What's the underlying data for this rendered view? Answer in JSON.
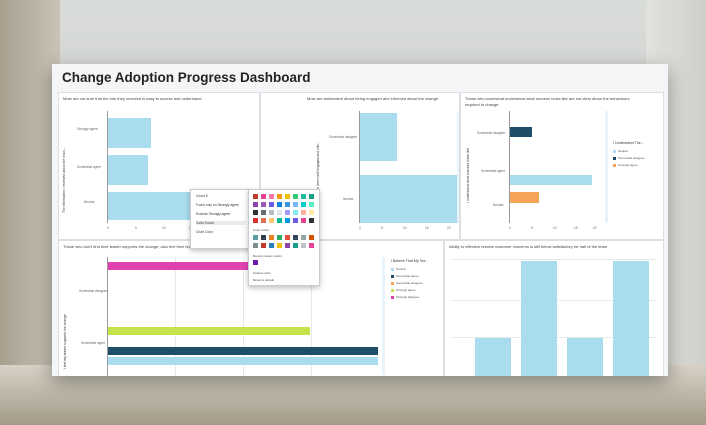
{
  "dashboard": {
    "title": "Change Adoption Progress Dashboard"
  },
  "colors": {
    "light_blue": "#a8dcee",
    "dark_blue": "#1f4e6b",
    "orange": "#f5a55a",
    "lime": "#c5e34a",
    "magenta": "#e040b0"
  },
  "panel1": {
    "title": "Most are not sure that the info they received is easy to access and understand",
    "y_axis": "The information I received about the chan...",
    "categories": [
      "Strongly agree",
      "Somewhat agree",
      "Neutral"
    ],
    "x_ticks": [
      "0",
      "5",
      "10",
      "15",
      "20",
      "25",
      "30"
    ]
  },
  "panel2": {
    "title": "Most are ambivalent about being engaged and informed about the change",
    "y_axis": "I feel that I have been well engaged and info...",
    "categories": [
      "Somewhat disagree",
      "Neutral"
    ],
    "x_ticks": [
      "0",
      "5",
      "10",
      "15",
      "20",
      "25",
      "30"
    ]
  },
  "panel3": {
    "title_line1": "Those who somewhat understand what success looks like are not clear about the behaviours",
    "title_line2": "required to change.",
    "y_axis": "I understand what success looks like",
    "categories": [
      "Somewhat disagree",
      "Somewhat agree",
      "Neutral"
    ],
    "x_ticks": [
      "0",
      "5",
      "10",
      "15",
      "20"
    ],
    "legend_title": "I Understand The...",
    "legend": [
      "Neutral",
      "Somewhat disagree",
      "Strongly agree"
    ]
  },
  "panel4": {
    "title": "Those who don't find their leader supports the change, also feel their team do not support the change.",
    "y_axis": "I feel my leader supports the change",
    "categories": [
      "Somewhat disagree",
      "Somewhat agree"
    ],
    "legend_title": "I Believe That My Tea...",
    "legend": [
      "Neutral",
      "Somewhat agree",
      "Somewhat disagree",
      "Strongly agree",
      "Strongly disagree"
    ]
  },
  "panel5": {
    "title": "Ability to effective resolve customer concerns is still below satisfactory for half of the team"
  },
  "context_menu": {
    "items": [
      "Count 8",
      "Focus only on Strongly agree",
      "Exclude Strongly agree",
      "Color Count",
      "Chart Color"
    ]
  },
  "color_picker": {
    "label_colors": "Color colors",
    "label_recent": "Recent custom colors",
    "label_custom": "Custom color",
    "label_reset": "Reset to default"
  },
  "visual_controls": {
    "label": "↗ ⋯"
  },
  "chart_data": [
    {
      "type": "bar",
      "title": "Most are not sure that the info they received is easy to access and understand",
      "categories": [
        "Strongly agree",
        "Somewhat agree",
        "Neutral"
      ],
      "values": [
        9,
        13,
        25
      ],
      "xlim": [
        0,
        30
      ]
    },
    {
      "type": "bar",
      "title": "Most are ambivalent about being engaged and informed about the change",
      "categories": [
        "Somewhat disagree",
        "Neutral"
      ],
      "values": [
        7,
        28
      ],
      "xlim": [
        0,
        30
      ]
    },
    {
      "type": "bar",
      "title": "Those who somewhat understand what success looks like are not clear about the behaviours required to change.",
      "categories": [
        "Somewhat disagree",
        "Somewhat agree",
        "Neutral"
      ],
      "series": [
        {
          "name": "Neutral",
          "values": [
            0,
            16,
            0
          ]
        },
        {
          "name": "Somewhat disagree",
          "values": [
            3,
            0,
            0
          ]
        },
        {
          "name": "Strongly agree",
          "values": [
            0,
            0,
            4
          ]
        }
      ],
      "xlim": [
        0,
        22
      ]
    },
    {
      "type": "bar",
      "title": "Those who don't find their leader supports the change, also feel their team do not support the change.",
      "categories": [
        "Somewhat disagree",
        "Somewhat agree"
      ],
      "series": [
        {
          "name": "Neutral",
          "values": [
            0,
            10
          ]
        },
        {
          "name": "Somewhat agree",
          "values": [
            0,
            10
          ]
        },
        {
          "name": "Strongly agree",
          "values": [
            0,
            8
          ]
        },
        {
          "name": "Strongly disagree",
          "values": [
            8,
            0
          ]
        }
      ],
      "xlim": [
        0,
        10
      ]
    },
    {
      "type": "bar",
      "title": "Ability to effective resolve customer concerns is still below satisfactory for half of the team",
      "values": [
        1,
        4,
        1,
        4
      ],
      "ylim": [
        0,
        4.2
      ]
    }
  ]
}
